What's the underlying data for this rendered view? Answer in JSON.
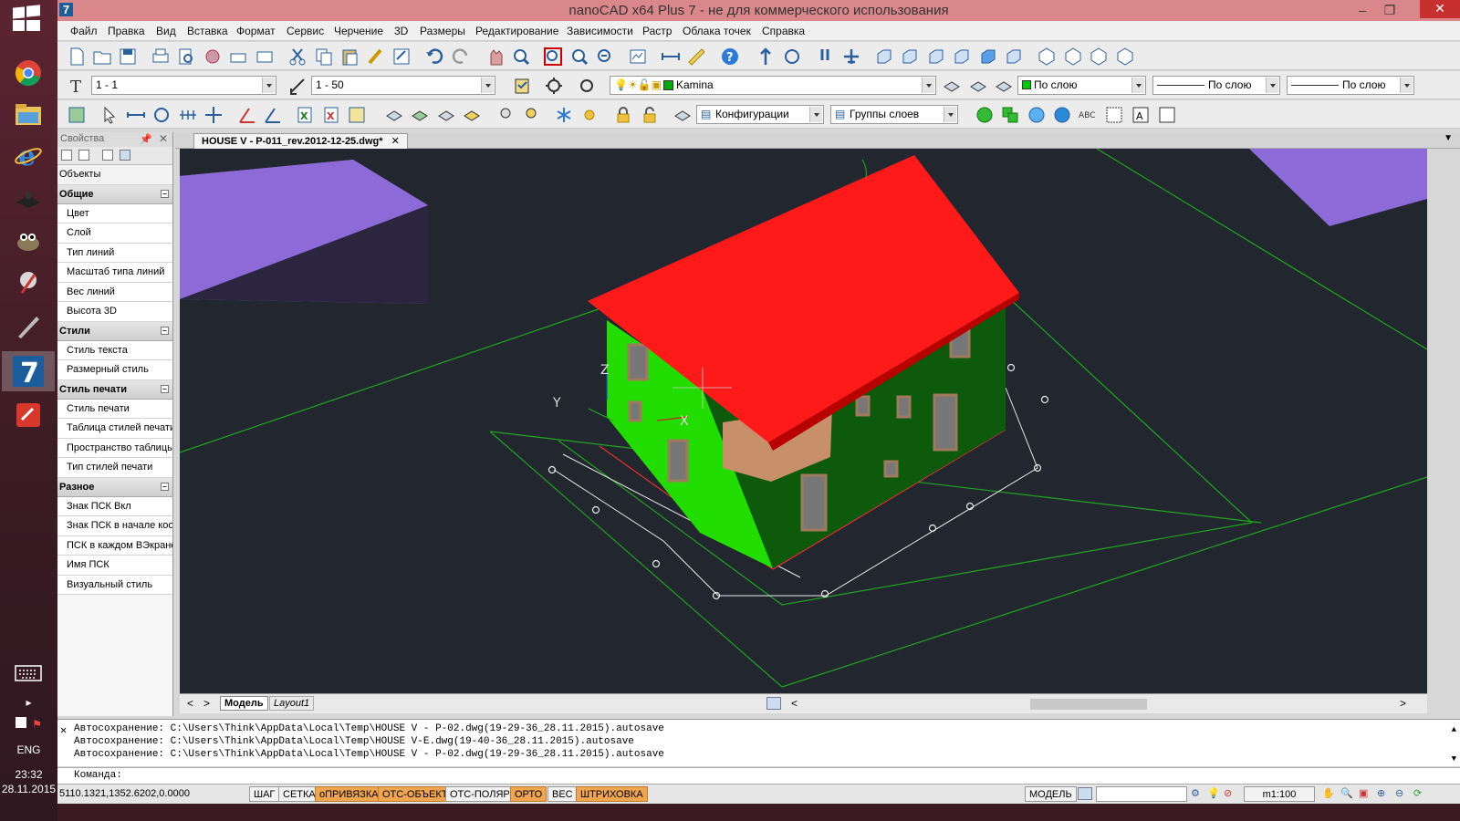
{
  "window": {
    "title": "nanoCAD x64 Plus 7 - не для коммерческого использования"
  },
  "menu": [
    "Файл",
    "Правка",
    "Вид",
    "Вставка",
    "Формат",
    "Сервис",
    "Черчение",
    "3D",
    "Размеры",
    "Редактирование",
    "Зависимости",
    "Растр",
    "Облака точек",
    "Справка"
  ],
  "toolbar2": {
    "textstyle": "1 - 1",
    "scale": "1 - 50",
    "layer": "Kamina",
    "color": "По слою",
    "linetype": "По слою",
    "lineweight": "По слою"
  },
  "toolbar3": {
    "configs": "Конфигурации",
    "layergroups": "Группы слоев"
  },
  "properties": {
    "title": "Свойства",
    "objects": "Объекты",
    "groups": [
      {
        "name": "Общие",
        "rows": [
          "Цвет",
          "Слой",
          "Тип линий",
          "Масштаб типа линий",
          "Вес линий",
          "Высота 3D"
        ]
      },
      {
        "name": "Стили",
        "rows": [
          "Стиль текста",
          "Размерный стиль"
        ]
      },
      {
        "name": "Стиль печати",
        "rows": [
          "Стиль печати",
          "Таблица стилей печати",
          "Пространство таблицы",
          "Тип стилей печати"
        ]
      },
      {
        "name": "Разное",
        "rows": [
          "Знак ПСК Вкл",
          "Знак ПСК в начале коо",
          "ПСК в каждом ВЭкране",
          "Имя ПСК",
          "Визуальный стиль"
        ]
      }
    ]
  },
  "document": {
    "tab": "HOUSE V - P-011_rev.2012-12-25.dwg*"
  },
  "viewport": {
    "axis_z": "Z",
    "axis_y": "Y",
    "axis_x": "X",
    "model_tab": "Модель",
    "layout_tab": "Layout1"
  },
  "log": [
    "Автосохранение: C:\\Users\\Think\\AppData\\Local\\Temp\\HOUSE V - P-02.dwg(19-29-36_28.11.2015).autosave",
    "Автосохранение: C:\\Users\\Think\\AppData\\Local\\Temp\\HOUSE V-E.dwg(19-40-36_28.11.2015).autosave",
    "Автосохранение: C:\\Users\\Think\\AppData\\Local\\Temp\\HOUSE V - P-02.dwg(19-29-36_28.11.2015).autosave"
  ],
  "command": {
    "label": "Команда:",
    "side": "Кома"
  },
  "status": {
    "coords": "5110.1321,1352.6202,0.0000",
    "toggles": [
      {
        "label": "ШАГ",
        "on": false
      },
      {
        "label": "СЕТКА",
        "on": false
      },
      {
        "label": "оПРИВЯЗКА",
        "on": true
      },
      {
        "label": "ОТС-ОБЪЕКТ",
        "on": true
      },
      {
        "label": "ОТС-ПОЛЯР",
        "on": false
      },
      {
        "label": "ОРТО",
        "on": true
      },
      {
        "label": "ВЕС",
        "on": false
      },
      {
        "label": "ШТРИХОВКА",
        "on": true
      }
    ],
    "space": "МОДЕЛЬ",
    "scale": "m1:100"
  },
  "taskbar": {
    "lang": "ENG",
    "time": "23:32",
    "date": "28.11.2015"
  },
  "colors": {
    "roof": "#ff1a1a",
    "wall_lit": "#22dd00",
    "wall_dark": "#0d5a0d",
    "viewport_bg": "#22272f",
    "box": "#8c6ad8"
  }
}
